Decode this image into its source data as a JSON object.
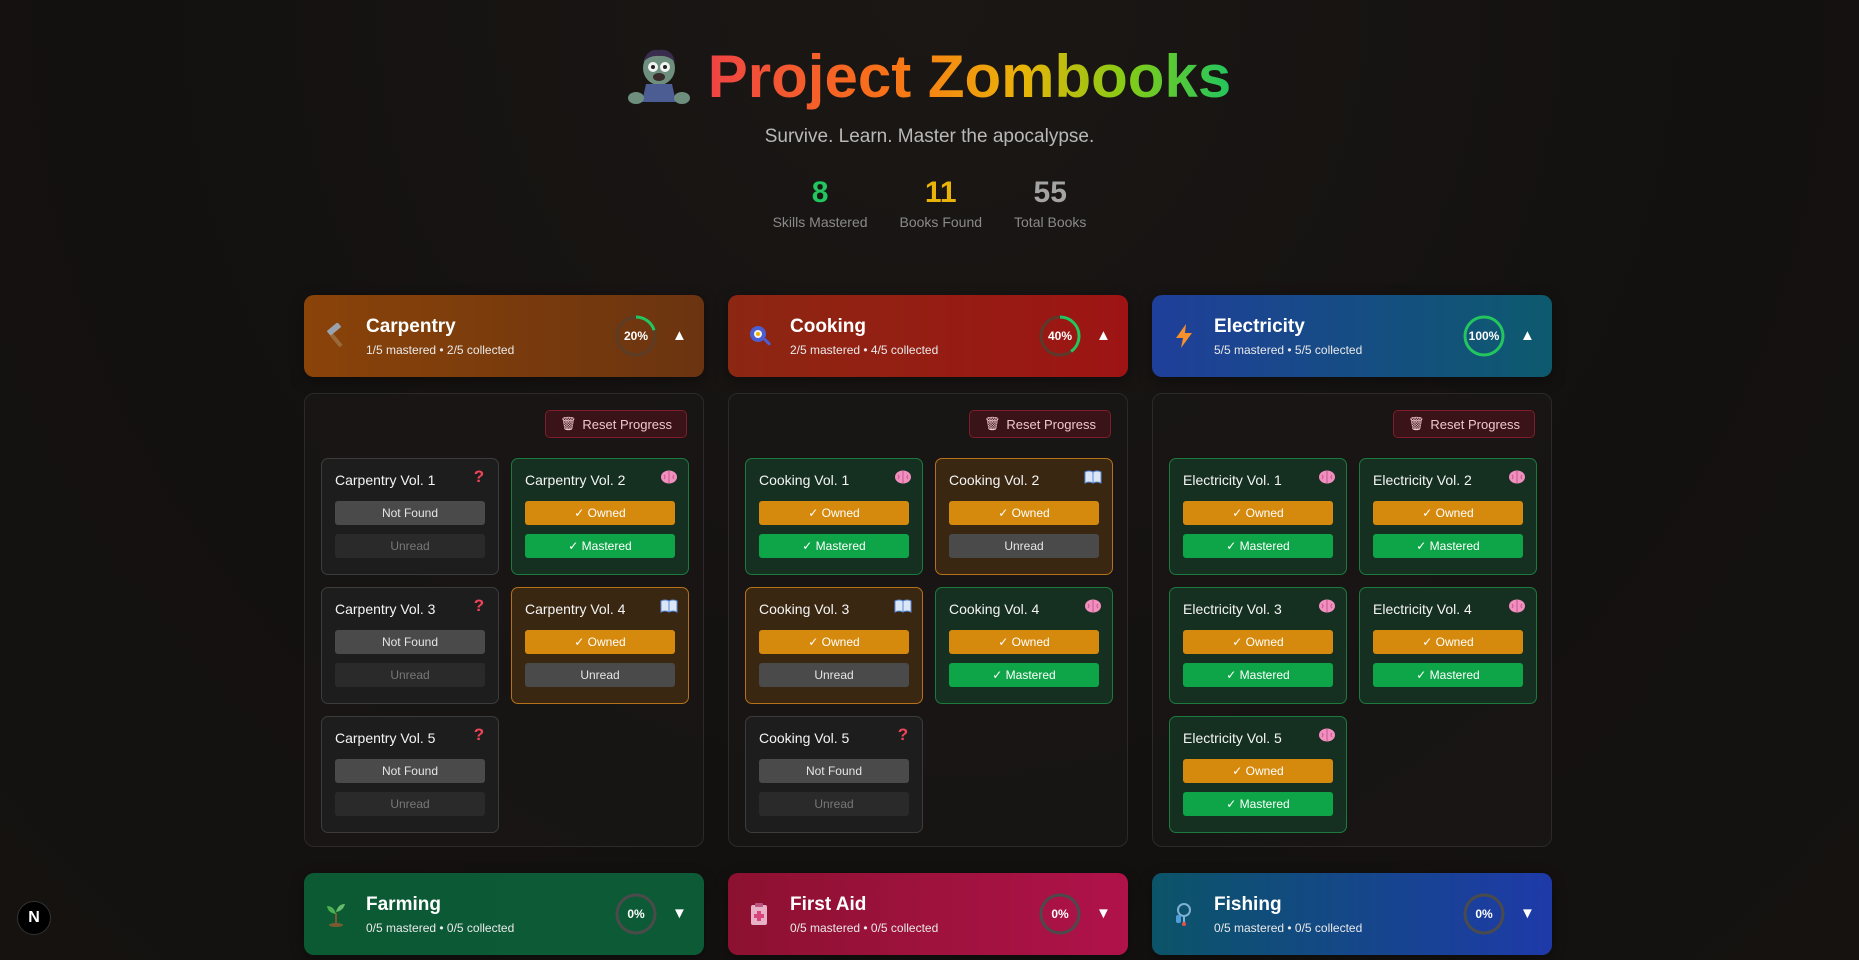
{
  "header": {
    "title": "Project Zombooks",
    "subtitle": "Survive. Learn. Master the apocalypse.",
    "stats": [
      {
        "value": "8",
        "label": "Skills Mastered",
        "color": "#22c55e"
      },
      {
        "value": "11",
        "label": "Books Found",
        "color": "#eab308"
      },
      {
        "value": "55",
        "label": "Total Books",
        "color": "#a3a3a3"
      }
    ]
  },
  "colors": {
    "owned": "#d58a0d",
    "mastered": "#0ea548",
    "reset": "#3a1318",
    "ring_track": "#4b4b4b",
    "ring_progress": "#22c55e"
  },
  "categories": [
    {
      "name": "Carpentry",
      "icon": "hammer-icon",
      "summary": "1/5 mastered • 2/5 collected",
      "progress_label": "20%",
      "progress": 0.2,
      "expanded": true,
      "gradient": [
        "#8a4309",
        "#6b3410"
      ]
    },
    {
      "name": "Cooking",
      "icon": "frying-pan-icon",
      "summary": "2/5 mastered • 4/5 collected",
      "progress_label": "40%",
      "progress": 0.4,
      "expanded": true,
      "gradient": [
        "#8c2712",
        "#9e1414"
      ]
    },
    {
      "name": "Electricity",
      "icon": "lightning-icon",
      "summary": "5/5 mastered • 5/5 collected",
      "progress_label": "100%",
      "progress": 1.0,
      "expanded": true,
      "gradient": [
        "#1f3f9a",
        "#0d5a6e"
      ]
    },
    {
      "name": "Farming",
      "icon": "sprout-icon",
      "summary": "0/5 mastered • 0/5 collected",
      "progress_label": "0%",
      "progress": 0.0,
      "expanded": false,
      "gradient": [
        "#0b5a34",
        "#0d5a37"
      ]
    },
    {
      "name": "First Aid",
      "icon": "first-aid-icon",
      "summary": "0/5 mastered • 0/5 collected",
      "progress_label": "0%",
      "progress": 0.0,
      "expanded": false,
      "gradient": [
        "#8c1130",
        "#b0124a"
      ]
    },
    {
      "name": "Fishing",
      "icon": "fishing-icon",
      "summary": "0/5 mastered • 0/5 collected",
      "progress_label": "0%",
      "progress": 0.0,
      "expanded": false,
      "gradient": [
        "#0b5468",
        "#1e3aa9"
      ]
    }
  ],
  "panel": {
    "reset_label": "Reset Progress"
  },
  "books": {
    "carpentry": [
      {
        "title": "Carpentry Vol. 1",
        "state": "notfound",
        "badge": "question-icon",
        "pill1": "Not Found",
        "pill2": "Unread"
      },
      {
        "title": "Carpentry Vol. 2",
        "state": "mastered",
        "badge": "brain-icon",
        "pill1": "✓ Owned",
        "pill2": "✓ Mastered"
      },
      {
        "title": "Carpentry Vol. 3",
        "state": "notfound",
        "badge": "question-icon",
        "pill1": "Not Found",
        "pill2": "Unread"
      },
      {
        "title": "Carpentry Vol. 4",
        "state": "owned",
        "badge": "book-icon",
        "pill1": "✓ Owned",
        "pill2": "Unread"
      },
      {
        "title": "Carpentry Vol. 5",
        "state": "notfound",
        "badge": "question-icon",
        "pill1": "Not Found",
        "pill2": "Unread"
      }
    ],
    "cooking": [
      {
        "title": "Cooking Vol. 1",
        "state": "mastered",
        "badge": "brain-icon",
        "pill1": "✓ Owned",
        "pill2": "✓ Mastered"
      },
      {
        "title": "Cooking Vol. 2",
        "state": "owned",
        "badge": "book-icon",
        "pill1": "✓ Owned",
        "pill2": "Unread"
      },
      {
        "title": "Cooking Vol. 3",
        "state": "owned",
        "badge": "book-icon",
        "pill1": "✓ Owned",
        "pill2": "Unread"
      },
      {
        "title": "Cooking Vol. 4",
        "state": "mastered",
        "badge": "brain-icon",
        "pill1": "✓ Owned",
        "pill2": "✓ Mastered"
      },
      {
        "title": "Cooking Vol. 5",
        "state": "notfound",
        "badge": "question-icon",
        "pill1": "Not Found",
        "pill2": "Unread"
      }
    ],
    "electricity": [
      {
        "title": "Electricity Vol. 1",
        "state": "mastered",
        "badge": "brain-icon",
        "pill1": "✓ Owned",
        "pill2": "✓ Mastered"
      },
      {
        "title": "Electricity Vol. 2",
        "state": "mastered",
        "badge": "brain-icon",
        "pill1": "✓ Owned",
        "pill2": "✓ Mastered"
      },
      {
        "title": "Electricity Vol. 3",
        "state": "mastered",
        "badge": "brain-icon",
        "pill1": "✓ Owned",
        "pill2": "✓ Mastered"
      },
      {
        "title": "Electricity Vol. 4",
        "state": "mastered",
        "badge": "brain-icon",
        "pill1": "✓ Owned",
        "pill2": "✓ Mastered"
      },
      {
        "title": "Electricity Vol. 5",
        "state": "mastered",
        "badge": "brain-icon",
        "pill1": "✓ Owned",
        "pill2": "✓ Mastered"
      }
    ]
  },
  "framework_badge": "N"
}
